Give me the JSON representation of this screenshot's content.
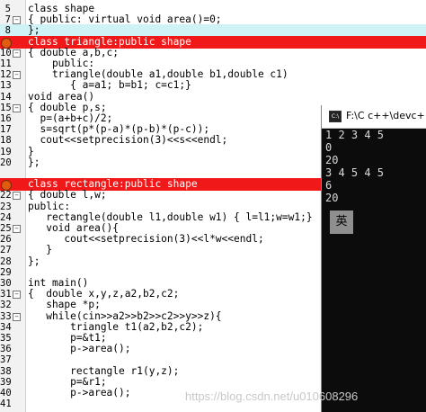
{
  "editor": {
    "lines": [
      {
        "n": "5",
        "code": "class shape",
        "hl": ""
      },
      {
        "n": "7",
        "code": "{ public: virtual void area()=0;",
        "hl": ""
      },
      {
        "n": "8",
        "code": "};",
        "hl": "cyan"
      },
      {
        "n": "",
        "code": "class triangle:public shape",
        "hl": "red",
        "bp": true
      },
      {
        "n": "10",
        "code": "{ double a,b,c;",
        "hl": ""
      },
      {
        "n": "11",
        "code": "    public:",
        "hl": ""
      },
      {
        "n": "12",
        "code": "    triangle(double a1,double b1,double c1)",
        "hl": ""
      },
      {
        "n": "13",
        "code": "       { a=a1; b=b1; c=c1;}",
        "hl": ""
      },
      {
        "n": "14",
        "code": "void area()",
        "hl": ""
      },
      {
        "n": "15",
        "code": "{ double p,s;",
        "hl": ""
      },
      {
        "n": "16",
        "code": "  p=(a+b+c)/2;",
        "hl": ""
      },
      {
        "n": "17",
        "code": "  s=sqrt(p*(p-a)*(p-b)*(p-c));",
        "hl": ""
      },
      {
        "n": "18",
        "code": "  cout<<setprecision(3)<<s<<endl;",
        "hl": ""
      },
      {
        "n": "19",
        "code": "}",
        "hl": ""
      },
      {
        "n": "20",
        "code": "};",
        "hl": ""
      },
      {
        "n": "",
        "code": "",
        "hl": ""
      },
      {
        "n": "",
        "code": "class rectangle:public shape",
        "hl": "red",
        "bp": true
      },
      {
        "n": "22",
        "code": "{ double l,w;",
        "hl": ""
      },
      {
        "n": "23",
        "code": "public:",
        "hl": ""
      },
      {
        "n": "24",
        "code": "   rectangle(double l1,double w1) { l=l1;w=w1;}",
        "hl": ""
      },
      {
        "n": "25",
        "code": "   void area(){",
        "hl": ""
      },
      {
        "n": "26",
        "code": "      cout<<setprecision(3)<<l*w<<endl;",
        "hl": ""
      },
      {
        "n": "27",
        "code": "   }",
        "hl": ""
      },
      {
        "n": "28",
        "code": "};",
        "hl": ""
      },
      {
        "n": "29",
        "code": "",
        "hl": ""
      },
      {
        "n": "30",
        "code": "int main()",
        "hl": ""
      },
      {
        "n": "31",
        "code": "{  double x,y,z,a2,b2,c2;",
        "hl": ""
      },
      {
        "n": "32",
        "code": "   shape *p;",
        "hl": ""
      },
      {
        "n": "33",
        "code": "   while(cin>>a2>>b2>>c2>>y>>z){",
        "hl": ""
      },
      {
        "n": "34",
        "code": "       triangle t1(a2,b2,c2);",
        "hl": ""
      },
      {
        "n": "35",
        "code": "       p=&t1;",
        "hl": ""
      },
      {
        "n": "36",
        "code": "       p->area();",
        "hl": ""
      },
      {
        "n": "37",
        "code": "",
        "hl": ""
      },
      {
        "n": "38",
        "code": "       rectangle r1(y,z);",
        "hl": ""
      },
      {
        "n": "39",
        "code": "       p=&r1;",
        "hl": ""
      },
      {
        "n": "40",
        "code": "       p->area();",
        "hl": ""
      },
      {
        "n": "41",
        "code": "",
        "hl": ""
      }
    ]
  },
  "console": {
    "title": "F:\\C c++\\devc++\\C",
    "output": [
      "1 2 3 4 5",
      "0",
      "20",
      "3 4 5 4 5",
      "6",
      "20"
    ],
    "ime_label": "英"
  },
  "watermark": "https://blog.csdn.net/u010608296"
}
